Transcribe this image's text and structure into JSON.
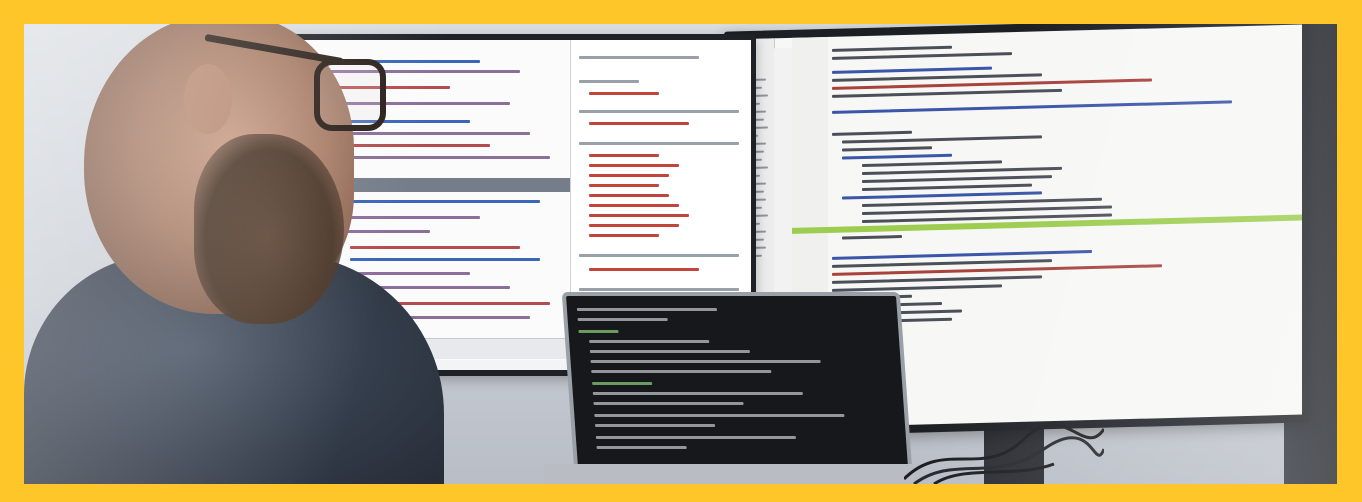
{
  "image": {
    "subject": "",
    "frame_color": "#ffc629"
  },
  "colors": {
    "frame": "#ffc629",
    "editor_highlight_green": "#9ccd4f",
    "laptop_screen": "#16181c",
    "shirt": "#333c4a"
  },
  "icons": [
    "photo-frame",
    "monitor",
    "laptop",
    "person"
  ]
}
